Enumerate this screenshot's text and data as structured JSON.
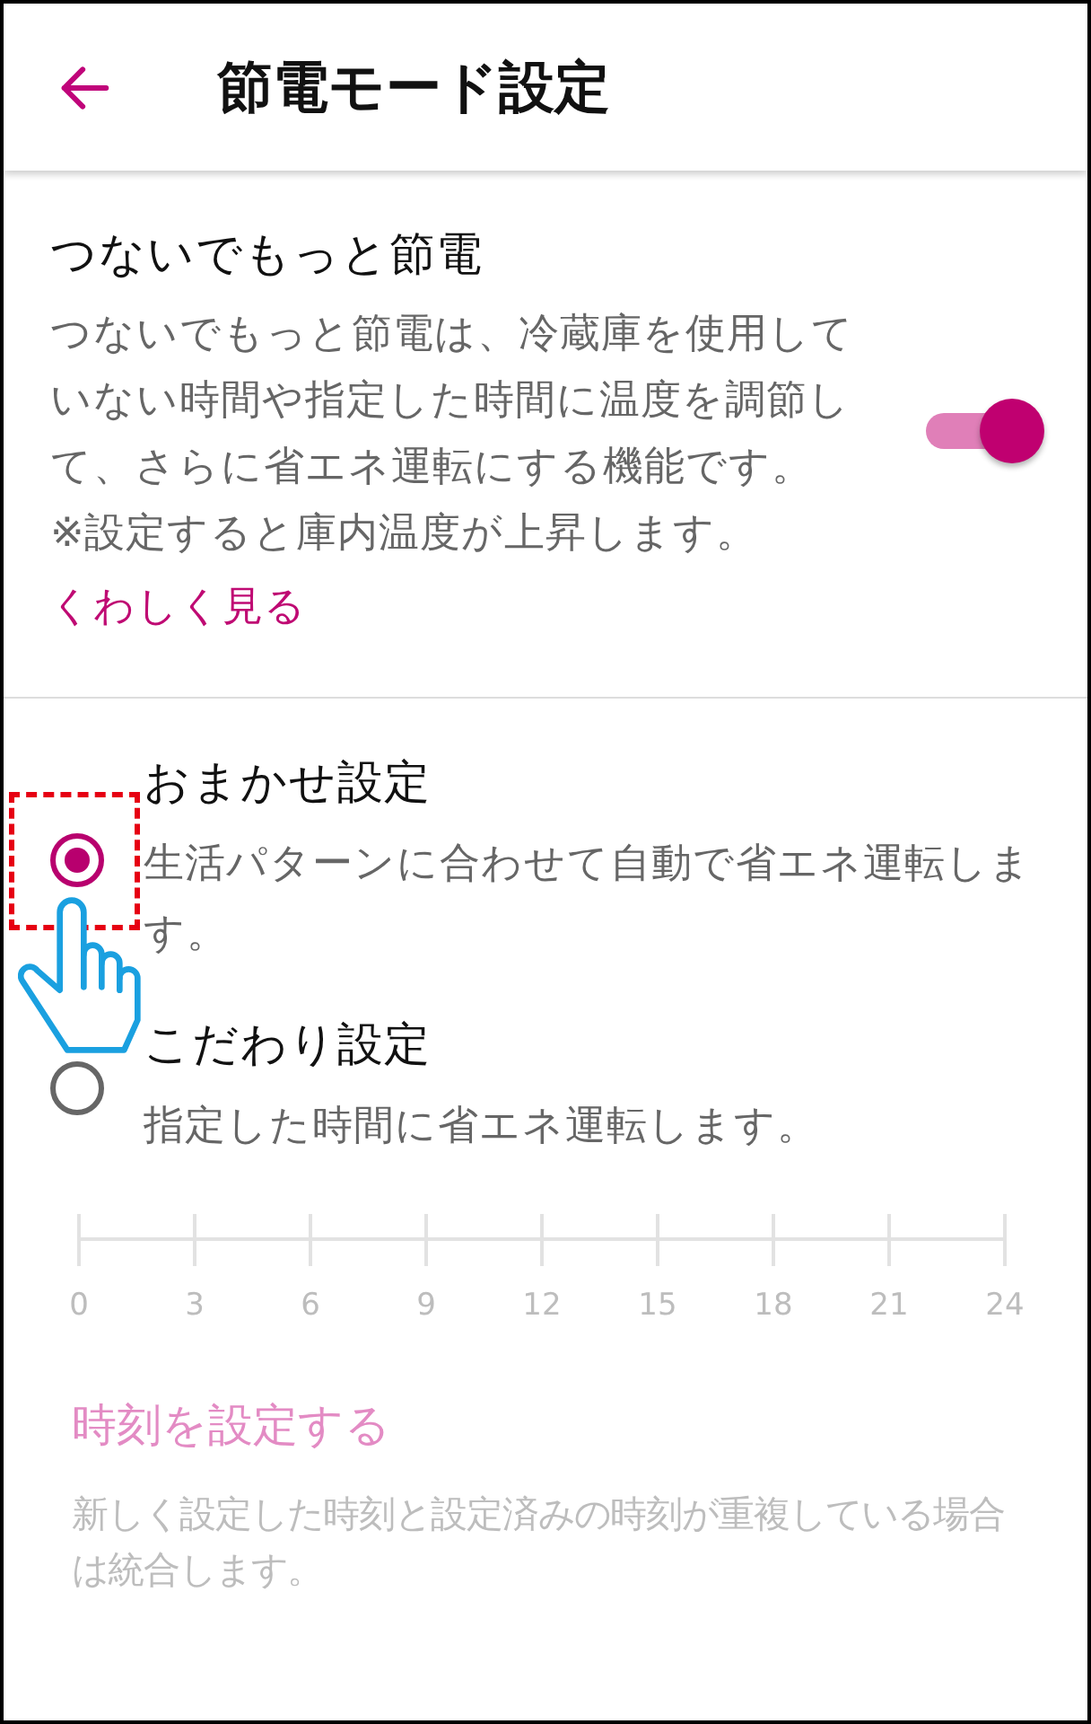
{
  "header": {
    "title": "節電モード設定"
  },
  "feature": {
    "title": "つないでもっと節電",
    "description": "つないでもっと節電は、冷蔵庫を使用していない時間や指定した時間に温度を調節して、さらに省エネ運転にする機能です。",
    "note": "※設定すると庫内温度が上昇します。",
    "link": "くわしく見る",
    "on": true
  },
  "modes": [
    {
      "label": "おまかせ設定",
      "description": "生活パターンに合わせて自動で省エネ運転します。",
      "selected": true
    },
    {
      "label": "こだわり設定",
      "description": "指定した時間に省エネ運転します。",
      "selected": false
    }
  ],
  "schedule": {
    "disabled": true,
    "timeline": {
      "ticks": [
        "0",
        "3",
        "6",
        "9",
        "12",
        "15",
        "18",
        "21",
        "24"
      ]
    },
    "set_time": "時刻を設定する",
    "note": "新しく設定した時刻と設定済みの時刻が重複している場合は統合します。"
  }
}
